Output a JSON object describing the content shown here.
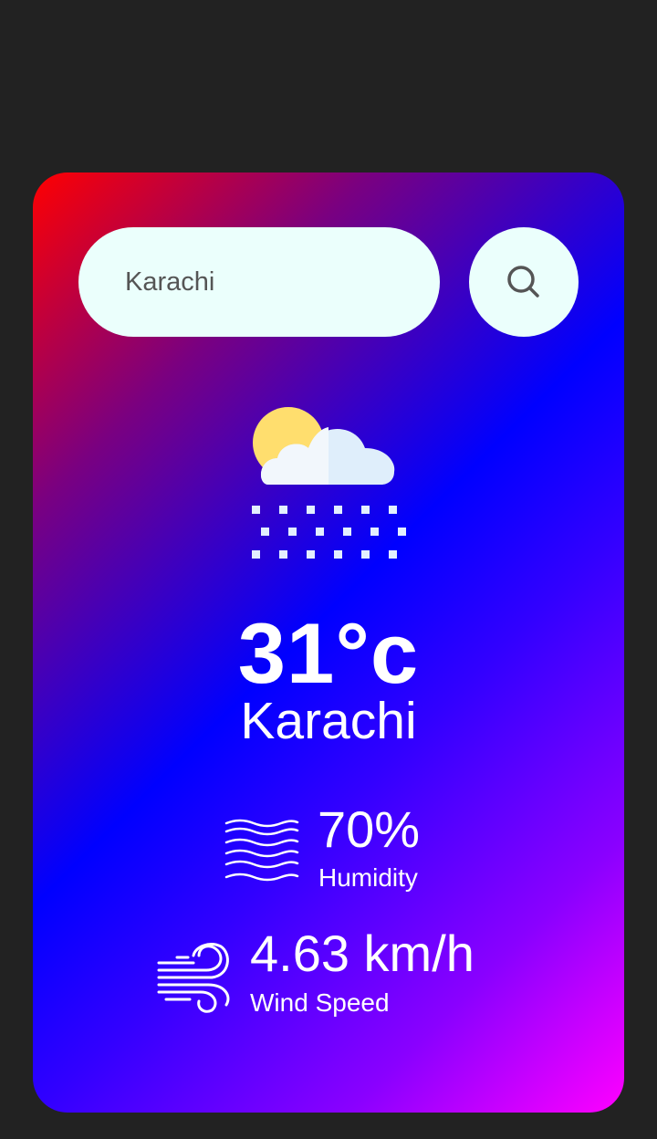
{
  "search": {
    "value": "Karachi"
  },
  "weather": {
    "icon": "sun-cloud-snow-icon",
    "temperature": "31°c",
    "city": "Karachi"
  },
  "humidity": {
    "icon": "humidity-waves-icon",
    "value": "70%",
    "label": "Humidity"
  },
  "wind": {
    "icon": "wind-icon",
    "value": "4.63 km/h",
    "label": "Wind Speed"
  },
  "colors": {
    "background": "#222222",
    "gradient_start": "#ff0000",
    "gradient_mid": "#0000ff",
    "gradient_end": "#ff00ff",
    "input_background": "#ebfffc",
    "text": "#ffffff"
  }
}
